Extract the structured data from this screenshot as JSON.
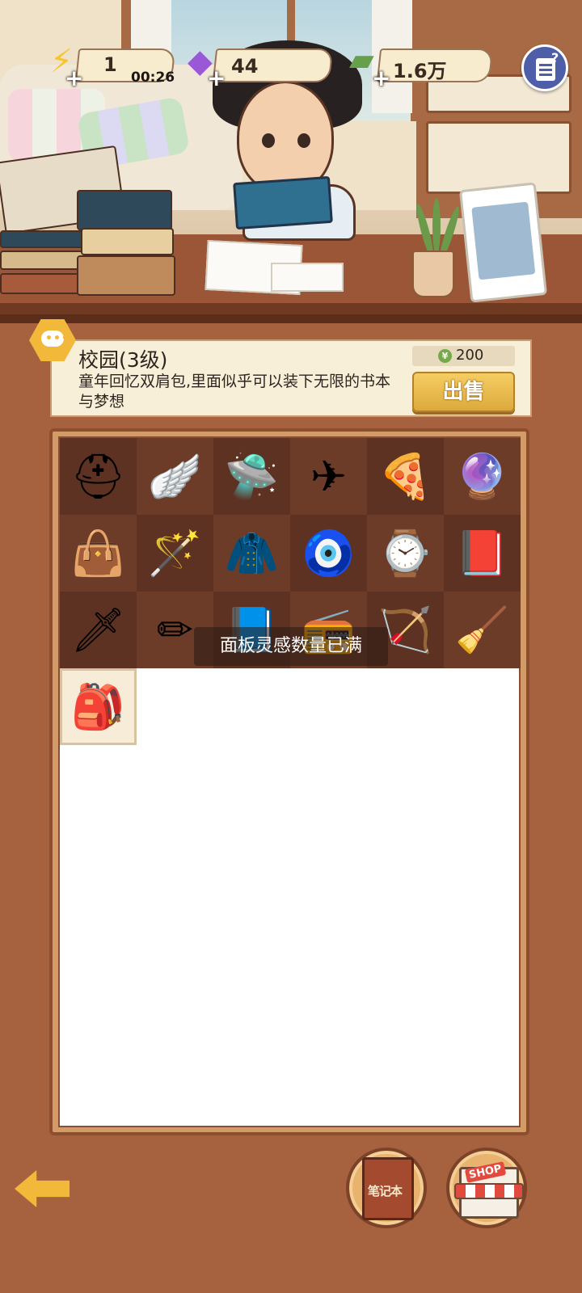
{
  "resources": {
    "energy": {
      "icon": "lightning-icon",
      "value": "1",
      "timer": "00:26"
    },
    "gems": {
      "icon": "purple-gem-icon",
      "value": "44"
    },
    "cash": {
      "icon": "cash-stack-icon",
      "value": "1.6万"
    }
  },
  "item": {
    "title": "校园(3级)",
    "description": "童年回忆双肩包,里面似乎可以装下无限的书本与梦想",
    "price": "200",
    "sell_label": "出售"
  },
  "inventory": [
    {
      "name": "viking-helmet-icon",
      "glyph": "⛑"
    },
    {
      "name": "angel-wings-icon",
      "glyph": "🪽"
    },
    {
      "name": "ufo-icon",
      "glyph": "🛸"
    },
    {
      "name": "airplane-icon",
      "glyph": "✈"
    },
    {
      "name": "pizza-slice-icon",
      "glyph": "🍕"
    },
    {
      "name": "crystal-ball-icon",
      "glyph": "🔮"
    },
    {
      "name": "shoulder-bag-icon",
      "glyph": "👜"
    },
    {
      "name": "magic-staff-icon",
      "glyph": "🪄"
    },
    {
      "name": "straw-cape-icon",
      "glyph": "🧥"
    },
    {
      "name": "jade-pendant-icon",
      "glyph": "🧿"
    },
    {
      "name": "wristwatch-icon",
      "glyph": "⌚"
    },
    {
      "name": "exam-book-icon",
      "glyph": "📕"
    },
    {
      "name": "sword-icon",
      "glyph": "🗡"
    },
    {
      "name": "pencil-icon",
      "glyph": "✏"
    },
    {
      "name": "blue-book-icon",
      "glyph": "📘"
    },
    {
      "name": "walkie-talkie-icon",
      "glyph": "📻"
    },
    {
      "name": "bow-arrow-icon",
      "glyph": "🏹"
    },
    {
      "name": "broom-icon",
      "glyph": "🧹"
    },
    {
      "name": "backpack-icon",
      "glyph": "🎒"
    }
  ],
  "toast": "面板灵感数量已满",
  "bottom": {
    "notebook_label": "笔记本",
    "shop_label": "SHOP"
  },
  "colors": {
    "accent": "#f2b83a",
    "background": "#a6613f",
    "panel": "#f8efd9"
  }
}
